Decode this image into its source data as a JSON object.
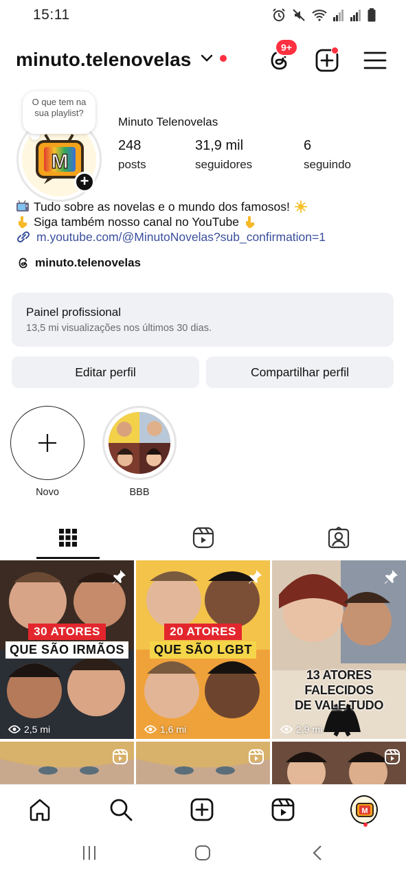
{
  "status_bar": {
    "time": "15:11",
    "icons": [
      "alarm-icon",
      "mute-icon",
      "wifi-icon",
      "signal-icon",
      "signal-icon",
      "battery-icon"
    ]
  },
  "header": {
    "username": "minuto.telenovelas",
    "notification_badge": "9+",
    "accent_color": "#ff3040"
  },
  "profile": {
    "note": "O que tem na sua playlist?",
    "display_name": "Minuto Telenovelas",
    "stats": {
      "posts_value": "248",
      "posts_label": "posts",
      "followers_value": "31,9 mil",
      "followers_label": "seguidores",
      "following_value": "6",
      "following_label": "seguindo"
    },
    "bio": {
      "line1": "Tudo sobre as novelas e o mundo dos famosos!",
      "line2": "Siga também nosso canal no YouTube",
      "link": "m.youtube.com/@MinutoNovelas?sub_confirmation=1"
    },
    "threads_handle": "minuto.telenovelas"
  },
  "professional_panel": {
    "title": "Painel profissional",
    "subtitle": "13,5 mi visualizações nos últimos 30 dias."
  },
  "actions": {
    "edit_label": "Editar perfil",
    "share_label": "Compartilhar perfil"
  },
  "highlights": [
    {
      "label": "Novo"
    },
    {
      "label": "BBB"
    }
  ],
  "tabs": [
    "grid-icon",
    "reels-icon",
    "tagged-icon"
  ],
  "posts": [
    {
      "line1": "30 ATORES",
      "line2": "QUE SÃO IRMÃOS",
      "views": "2,5 mi",
      "pinned": true
    },
    {
      "line1": "20 ATORES",
      "line2": "QUE SÃO LGBT",
      "views": "1,6 mi",
      "pinned": true
    },
    {
      "line1": "13 ATORES FALECIDOS",
      "line2": "DE VALE TUDO",
      "views": "2,9 mi",
      "pinned": true
    }
  ],
  "bottom_nav": [
    "home-icon",
    "search-icon",
    "create-icon",
    "reels-icon",
    "profile-avatar"
  ]
}
